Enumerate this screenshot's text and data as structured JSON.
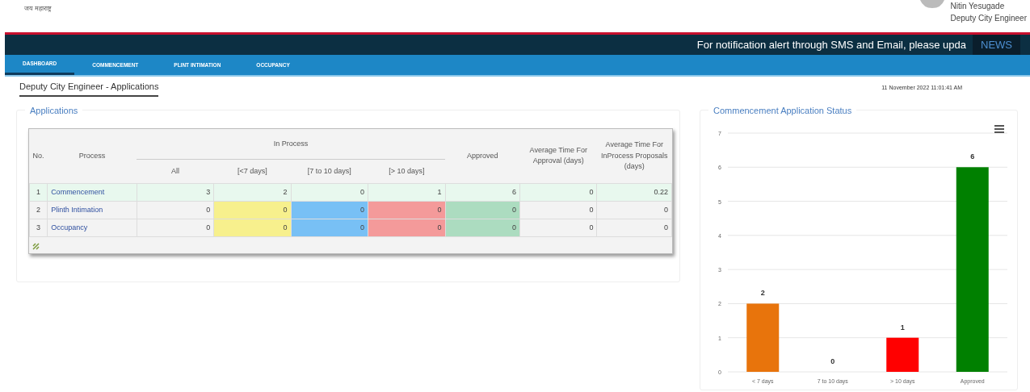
{
  "header": {
    "tagline": "जय महाराष्ट्र",
    "user_name": "Nitin Yesugade",
    "user_role": "Deputy City Engineer"
  },
  "news": {
    "text": "For notification alert through SMS and Email, please upda",
    "label": "NEWS"
  },
  "nav": [
    {
      "label": "DASHBOARD",
      "selected": true
    },
    {
      "label": "COMMENCEMENT",
      "selected": false
    },
    {
      "label": "PLINT INTIMATION",
      "selected": false
    },
    {
      "label": "OCCUPANCY",
      "selected": false
    }
  ],
  "page": {
    "title": "Deputy City Engineer - Applications",
    "datetime": "11 November 2022 11:01:41 AM"
  },
  "applications": {
    "title": "Applications",
    "columns": {
      "no": "No.",
      "process": "Process",
      "in_process": "In Process",
      "sub": [
        "All",
        "[<7 days]",
        "[7 to 10 days]",
        "[> 10 days]"
      ],
      "approved": "Approved",
      "avg_approval": "Average Time For Approval (days)",
      "avg_inprocess": "Average Time For InProcess Proposals (days)"
    },
    "rows": [
      {
        "no": "1",
        "process": "Commencement",
        "all": "3",
        "lt7": "2",
        "d7to10": "0",
        "gt10": "1",
        "approved": "6",
        "avg_approval": "0",
        "avg_inprocess": "0.22",
        "selected": true
      },
      {
        "no": "2",
        "process": "Plinth Intimation",
        "all": "0",
        "lt7": "0",
        "d7to10": "0",
        "gt10": "0",
        "approved": "0",
        "avg_approval": "0",
        "avg_inprocess": "0",
        "selected": false
      },
      {
        "no": "3",
        "process": "Occupancy",
        "all": "0",
        "lt7": "0",
        "d7to10": "0",
        "gt10": "0",
        "approved": "0",
        "avg_approval": "0",
        "avg_inprocess": "0",
        "selected": false
      }
    ]
  },
  "chart_panel": {
    "title": "Commencement Application Status",
    "chart_data": {
      "type": "bar",
      "categories": [
        "< 7 days",
        "7 to 10 days",
        "> 10 days",
        "Approved"
      ],
      "series": [
        {
          "color": "#e8740c",
          "values": [
            2,
            null,
            null,
            null
          ]
        },
        {
          "color": "#1e90ff",
          "values": [
            null,
            0,
            null,
            null
          ]
        },
        {
          "color": "#ff0000",
          "values": [
            null,
            null,
            1,
            null
          ]
        },
        {
          "color": "#008000",
          "values": [
            null,
            null,
            null,
            6
          ]
        }
      ],
      "stacked": true,
      "grid": true,
      "ylim": [
        0,
        7
      ],
      "yticks": [
        0,
        1,
        2,
        3,
        4,
        5,
        6,
        7
      ],
      "data_labels": true
    }
  }
}
